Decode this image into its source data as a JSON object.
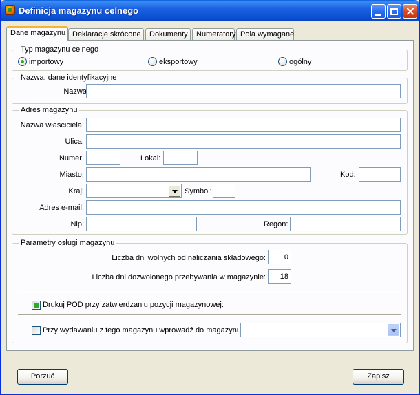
{
  "window": {
    "title": "Definicja magazynu celnego"
  },
  "tabs": [
    "Dane magazynu",
    "Deklaracje skrócone",
    "Dokumenty",
    "Numeratory",
    "Pola wymagane"
  ],
  "typ": {
    "legend": "Typ magazynu celnego",
    "options": [
      "importowy",
      "eksportowy",
      "ogólny"
    ],
    "selected": "importowy"
  },
  "ident": {
    "legend": "Nazwa, dane identyfikacyjne",
    "nazwa_label": "Nazwa:",
    "nazwa_value": ""
  },
  "adres": {
    "legend": "Adres magazynu",
    "wlasciciel_label": "Nazwa właściciela:",
    "ulica_label": "Ulica:",
    "numer_label": "Numer:",
    "lokal_label": "Lokal:",
    "miasto_label": "Miasto:",
    "kod_label": "Kod:",
    "kraj_label": "Kraj:",
    "kraj_value": "",
    "symbol_label": "Symbol:",
    "email_label": "Adres e-mail:",
    "nip_label": "Nip:",
    "regon_label": "Regon:"
  },
  "params": {
    "legend": "Parametry osługi magazynu",
    "dni_wolnych_label": "Liczba dni wolnych od naliczania składowego:",
    "dni_wolnych_value": "0",
    "dni_przebywania_label": "Liczba dni dozwolonego przebywania w magazynie:",
    "dni_przebywania_value": "18",
    "drukuj_label": "Drukuj POD przy zatwierdzaniu pozycji magazynowej:",
    "drukuj_checked": true,
    "wydawanie_label": "Przy wydawaniu z tego magazynu wprowadź do magazynu:",
    "wydawanie_checked": false,
    "wydawanie_value": ""
  },
  "buttons": {
    "cancel": "Porzuć",
    "save": "Zapisz"
  },
  "colors": {
    "titlebar": "#0b4fd2",
    "window": "#ece9d8",
    "accent": "#2fa82f"
  }
}
